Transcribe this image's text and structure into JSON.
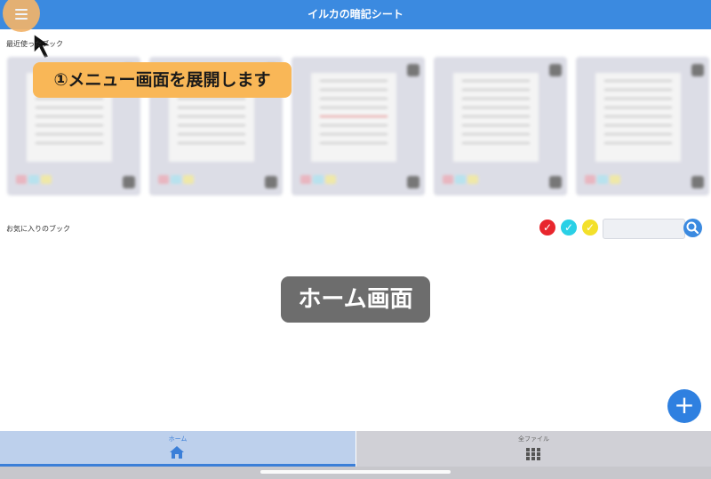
{
  "header": {
    "title": "イルカの暗記シート"
  },
  "sections": {
    "recent_label": "最近使ったブック",
    "favorites_label": "お気に入りのブック"
  },
  "tutorial": {
    "callout_text": "①メニュー画面を展開します",
    "screen_label": "ホーム画面"
  },
  "filters": {
    "colors": [
      "#e8262d",
      "#2ad0e6",
      "#f3e02a"
    ],
    "search_placeholder": ""
  },
  "fab": {
    "icon": "plus-icon",
    "label": "+"
  },
  "tabbar": {
    "tabs": [
      {
        "label": "ホーム",
        "icon": "home-icon",
        "active": true
      },
      {
        "label": "全ファイル",
        "icon": "grid-icon",
        "active": false
      }
    ]
  },
  "colors": {
    "accent": "#3b8ae0",
    "callout": "#f9b757",
    "menu_highlight": "#f2b46a"
  }
}
